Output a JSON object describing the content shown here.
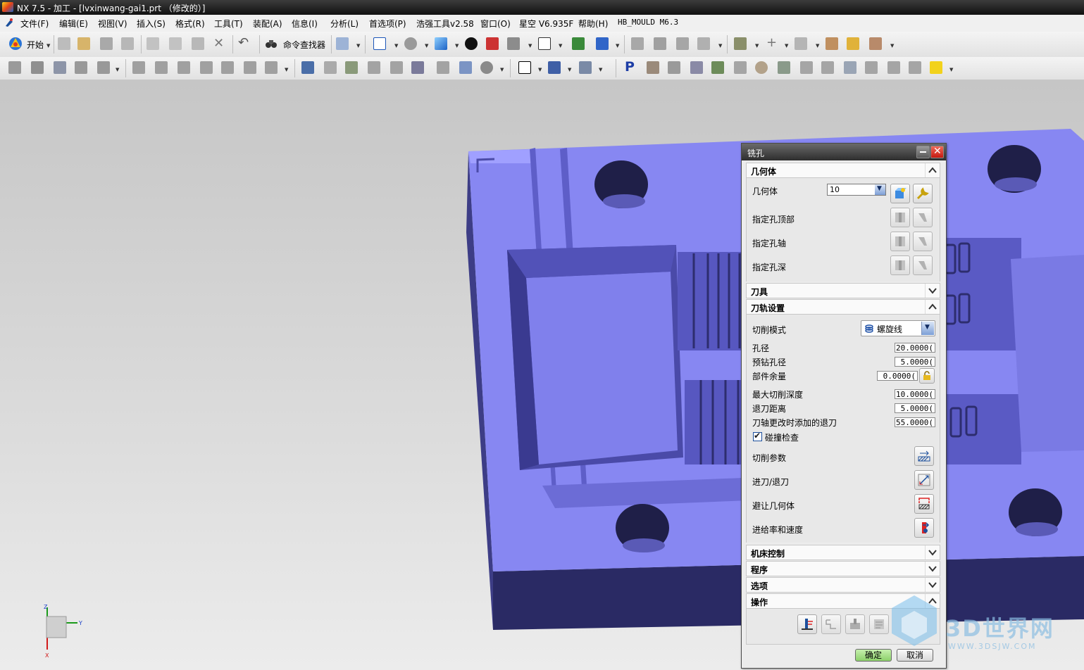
{
  "window": {
    "title": "NX 7.5 - 加工 - [lvxinwang-gai1.prt （修改的）]"
  },
  "menu": {
    "items": [
      "文件(F)",
      "编辑(E)",
      "视图(V)",
      "插入(S)",
      "格式(R)",
      "工具(T)",
      "装配(A)",
      "信息(I)",
      "分析(L)",
      "首选项(P)",
      "浩强工具v2.58",
      "窗口(O)",
      "星空 V6.935F",
      "帮助(H)",
      "HB_MOULD M6.3"
    ]
  },
  "toolbar": {
    "start_label": "开始",
    "command_finder_label": "命令查找器"
  },
  "triad": {
    "x": "X",
    "y": "Y",
    "z": "Z"
  },
  "dialog": {
    "title": "铣孔",
    "geometry": {
      "header": "几何体",
      "geometry_label": "几何体",
      "geometry_value": "10",
      "hole_top_label": "指定孔顶部",
      "hole_axis_label": "指定孔轴",
      "hole_depth_label": "指定孔深"
    },
    "tool": {
      "header": "刀具"
    },
    "path": {
      "header": "刀轨设置",
      "cut_mode_label": "切削模式",
      "cut_mode_value": "螺旋线",
      "hole_dia_label": "孔径",
      "hole_dia_value": "20.0000(",
      "predrill_label": "预钻孔径",
      "predrill_value": "5.0000(",
      "stock_label": "部件余量",
      "stock_value": "0.0000(",
      "max_depth_label": "最大切削深度",
      "max_depth_value": "10.0000(",
      "retract_label": "退刀距离",
      "retract_value": "5.0000(",
      "axis_retract_label": "刀轴更改时添加的退刀",
      "axis_retract_value": "55.0000(",
      "collision_label": "碰撞检查",
      "collision_checked": true,
      "cut_params_label": "切削参数",
      "engage_label": "进刀/退刀",
      "avoid_label": "避让几何体",
      "feeds_label": "进给率和速度"
    },
    "machine": {
      "header": "机床控制"
    },
    "program": {
      "header": "程序"
    },
    "options": {
      "header": "选项"
    },
    "actions": {
      "header": "操作"
    },
    "ok_label": "确定",
    "cancel_label": "取消"
  },
  "watermark": {
    "brand": "3D世界网",
    "url": "WWW.3DSJW.COM"
  },
  "colors": {
    "model_top": "#8686f0",
    "model_side": "#3b3b8a",
    "model_dark": "#20204a",
    "ok_green": "#9fdd80"
  }
}
